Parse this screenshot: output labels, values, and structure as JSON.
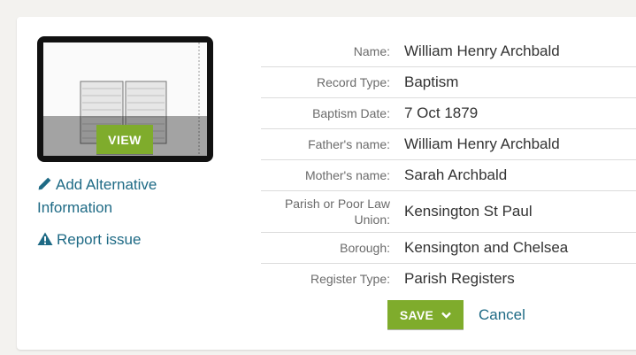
{
  "thumbnail": {
    "view_label": "VIEW"
  },
  "actions": {
    "add_alternative": "Add Alternative Information",
    "report_issue": "Report issue"
  },
  "record": [
    {
      "label": "Name:",
      "value": "William Henry Archbald"
    },
    {
      "label": "Record Type:",
      "value": "Baptism"
    },
    {
      "label": "Baptism Date:",
      "value": "7 Oct 1879"
    },
    {
      "label": "Father's name:",
      "value": "William Henry Archbald"
    },
    {
      "label": "Mother's name:",
      "value": "Sarah Archbald"
    },
    {
      "label": "Parish or Poor Law Union:",
      "value": "Kensington St Paul"
    },
    {
      "label": "Borough:",
      "value": "Kensington and Chelsea"
    },
    {
      "label": "Register Type:",
      "value": "Parish Registers"
    }
  ],
  "buttons": {
    "save": "SAVE",
    "cancel": "Cancel"
  },
  "colors": {
    "accent_green": "#7fac2c",
    "link_blue": "#1e6a85"
  }
}
